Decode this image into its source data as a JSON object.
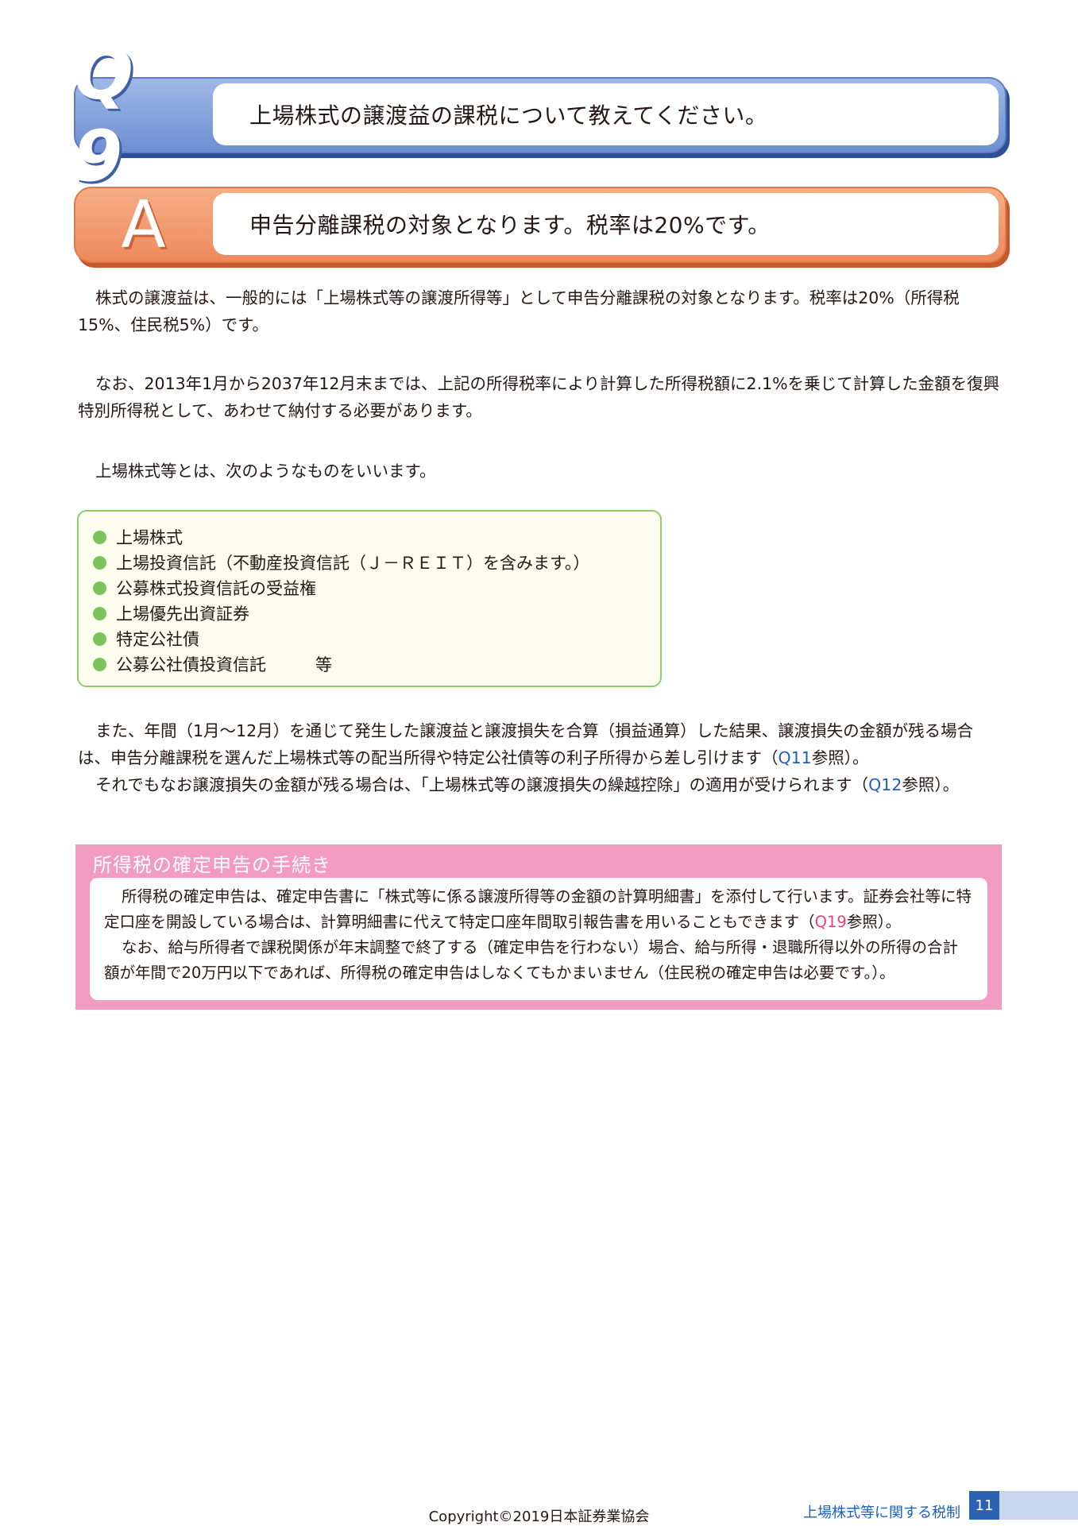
{
  "question": {
    "mark": "Q 9",
    "text": "上場株式の譲渡益の課税について教えてください。"
  },
  "answer": {
    "mark": "A",
    "text": "申告分離課税の対象となります。税率は20%です。"
  },
  "paragraphs": {
    "p1": "株式の譲渡益は、一般的には「上場株式等の譲渡所得等」として申告分離課税の対象となります。税率は20%（所得税15%、住民税5%）です。",
    "p2": "なお、2013年1月から2037年12月末までは、上記の所得税率により計算した所得税額に2.1%を乗じて計算した金額を復興特別所得税として、あわせて納付する必要があります。",
    "p3": "上場株式等とは、次のようなものをいいます。",
    "p4a": "また、年間（1月～12月）を通じて発生した譲渡益と譲渡損失を合算（損益通算）した結果、譲渡損失の金額が残る場合は、申告分離課税を選んだ上場株式等の配当所得や特定公社債等の利子所得から差し引けます（",
    "p4_ref": "Q11",
    "p4b": "参照）。",
    "p5a": "それでもなお譲渡損失の金額が残る場合は、「上場株式等の譲渡損失の繰越控除」の適用が受けられます（",
    "p5_ref": "Q12",
    "p5b": "参照）。"
  },
  "list": {
    "items": [
      "上場株式",
      "上場投資信託（不動産投資信託（Ｊ－ＲＥＩＴ）を含みます。）",
      "公募株式投資信託の受益権",
      "上場優先出資証券",
      "特定公社債",
      "公募公社債投資信託"
    ],
    "last_suffix": "等"
  },
  "procedures": {
    "title": "所得税の確定申告の手続き",
    "p1a": "所得税の確定申告は、確定申告書に「株式等に係る譲渡所得等の金額の計算明細書」を添付して行います。証券会社等に特定口座を開設している場合は、計算明細書に代えて特定口座年間取引報告書を用いることもできます（",
    "p1_ref": "Q19",
    "p1b": "参照）。",
    "p2": "なお、給与所得者で課税関係が年末調整で終了する（確定申告を行わない）場合、給与所得・退職所得以外の所得の合計額が年間で20万円以下であれば、所得税の確定申告はしなくてもかまいません（住民税の確定申告は必要です。）。"
  },
  "footer": {
    "section_label": "上場株式等に関する税制",
    "page_number": "11",
    "copyright": "Copyright©2019日本証券業協会"
  },
  "colors": {
    "question_blue": "#6d8fd2",
    "answer_orange": "#ee8a5c",
    "list_green": "#7cc35a",
    "procedure_pink": "#f29cc1",
    "reference_blue": "#1f5fb8",
    "reference_pink": "#e0457a"
  }
}
